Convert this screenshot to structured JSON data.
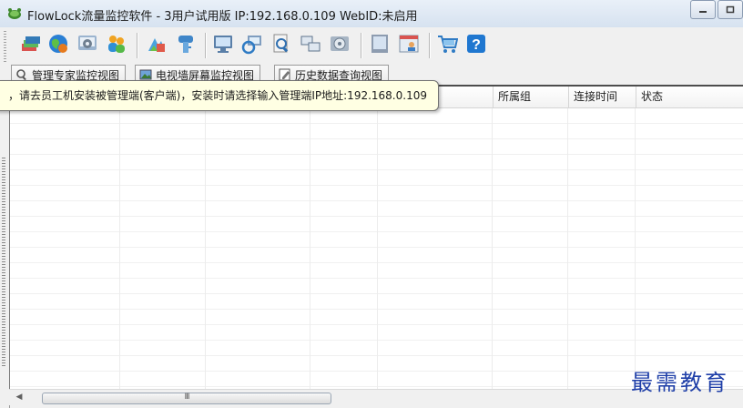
{
  "window": {
    "title": "FlowLock流量监控软件 - 3用户试用版 IP:192.168.0.109 WebID:未启用"
  },
  "toolbar": {
    "buttons": [
      {
        "icon": "layers-icon"
      },
      {
        "icon": "globe-icon"
      },
      {
        "icon": "settings-panel-icon"
      },
      {
        "icon": "users-icon"
      },
      {
        "icon": "report-icon"
      },
      {
        "icon": "key-icon"
      },
      {
        "icon": "monitor-icon"
      },
      {
        "icon": "refresh-monitor-icon"
      },
      {
        "icon": "document-search-icon"
      },
      {
        "icon": "network-icon"
      },
      {
        "icon": "disk-icon"
      },
      {
        "icon": "screen-icon"
      },
      {
        "icon": "person-card-icon"
      },
      {
        "icon": "cart-icon"
      },
      {
        "icon": "help-icon"
      }
    ]
  },
  "tabs": [
    {
      "label": "管理专家监控视图",
      "icon": "magnifier-icon"
    },
    {
      "label": "电视墙屏幕监控视图",
      "icon": "picture-icon"
    },
    {
      "label": "历史数据查询视图",
      "icon": "edit-icon"
    }
  ],
  "grid": {
    "columns": [
      {
        "label": ""
      },
      {
        "label": ""
      },
      {
        "label": ""
      },
      {
        "label": ""
      },
      {
        "label": "户"
      },
      {
        "label": "所属组"
      },
      {
        "label": "连接时间"
      },
      {
        "label": "状态"
      }
    ]
  },
  "tooltip": {
    "text": "，请去员工机安装被管理端(客户端)，安装时请选择输入管理端IP地址:192.168.0.109"
  },
  "scrollbar": {
    "thumb_grip": "III"
  },
  "watermark": {
    "text": "最需教育"
  },
  "colors": {
    "accent": "#1f3fa8",
    "tooltip_bg": "#ffffe3",
    "titlebar": "#dce6f2"
  }
}
